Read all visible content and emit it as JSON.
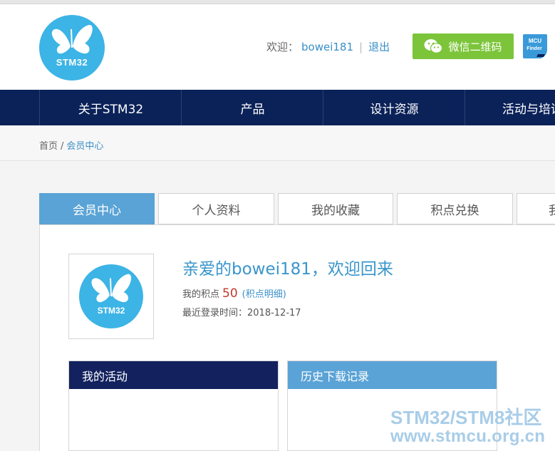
{
  "header": {
    "logo_text": "STM32",
    "welcome_label": "欢迎：",
    "username": "bowei181",
    "separator": "|",
    "logout_label": "退出",
    "wechat_label": "微信二维码",
    "mcu_finder_line1": "MCU",
    "mcu_finder_line2": "Finder"
  },
  "nav": {
    "items": [
      "关于STM32",
      "产品",
      "设计资源",
      "活动与培训"
    ]
  },
  "breadcrumb": {
    "home": "首页",
    "slash": "/",
    "current": "会员中心"
  },
  "tabs": [
    {
      "label": "会员中心",
      "active": true
    },
    {
      "label": "个人资料",
      "active": false
    },
    {
      "label": "我的收藏",
      "active": false
    },
    {
      "label": "积点兑换",
      "active": false
    },
    {
      "label": "我的",
      "active": false
    }
  ],
  "profile": {
    "avatar_text": "STM32",
    "greeting": "亲爱的bowei181，欢迎回来",
    "points_label": "我的积点",
    "points_value": "50",
    "paren_open": "(",
    "points_detail_label": "积点明细",
    "paren_close": ")",
    "last_login": "最近登录时间：2018-12-17"
  },
  "boxes": {
    "activity_title": "我的活动",
    "history_title": "历史下载记录"
  },
  "watermark": {
    "line1": "STM32/STM8社区",
    "line2": "www.stmcu.org.cn"
  },
  "colors": {
    "nav_bg": "#0b2259",
    "accent_blue": "#5aa3d6",
    "wechat_green": "#7cc53a",
    "logo_blue": "#3cb4e5"
  }
}
